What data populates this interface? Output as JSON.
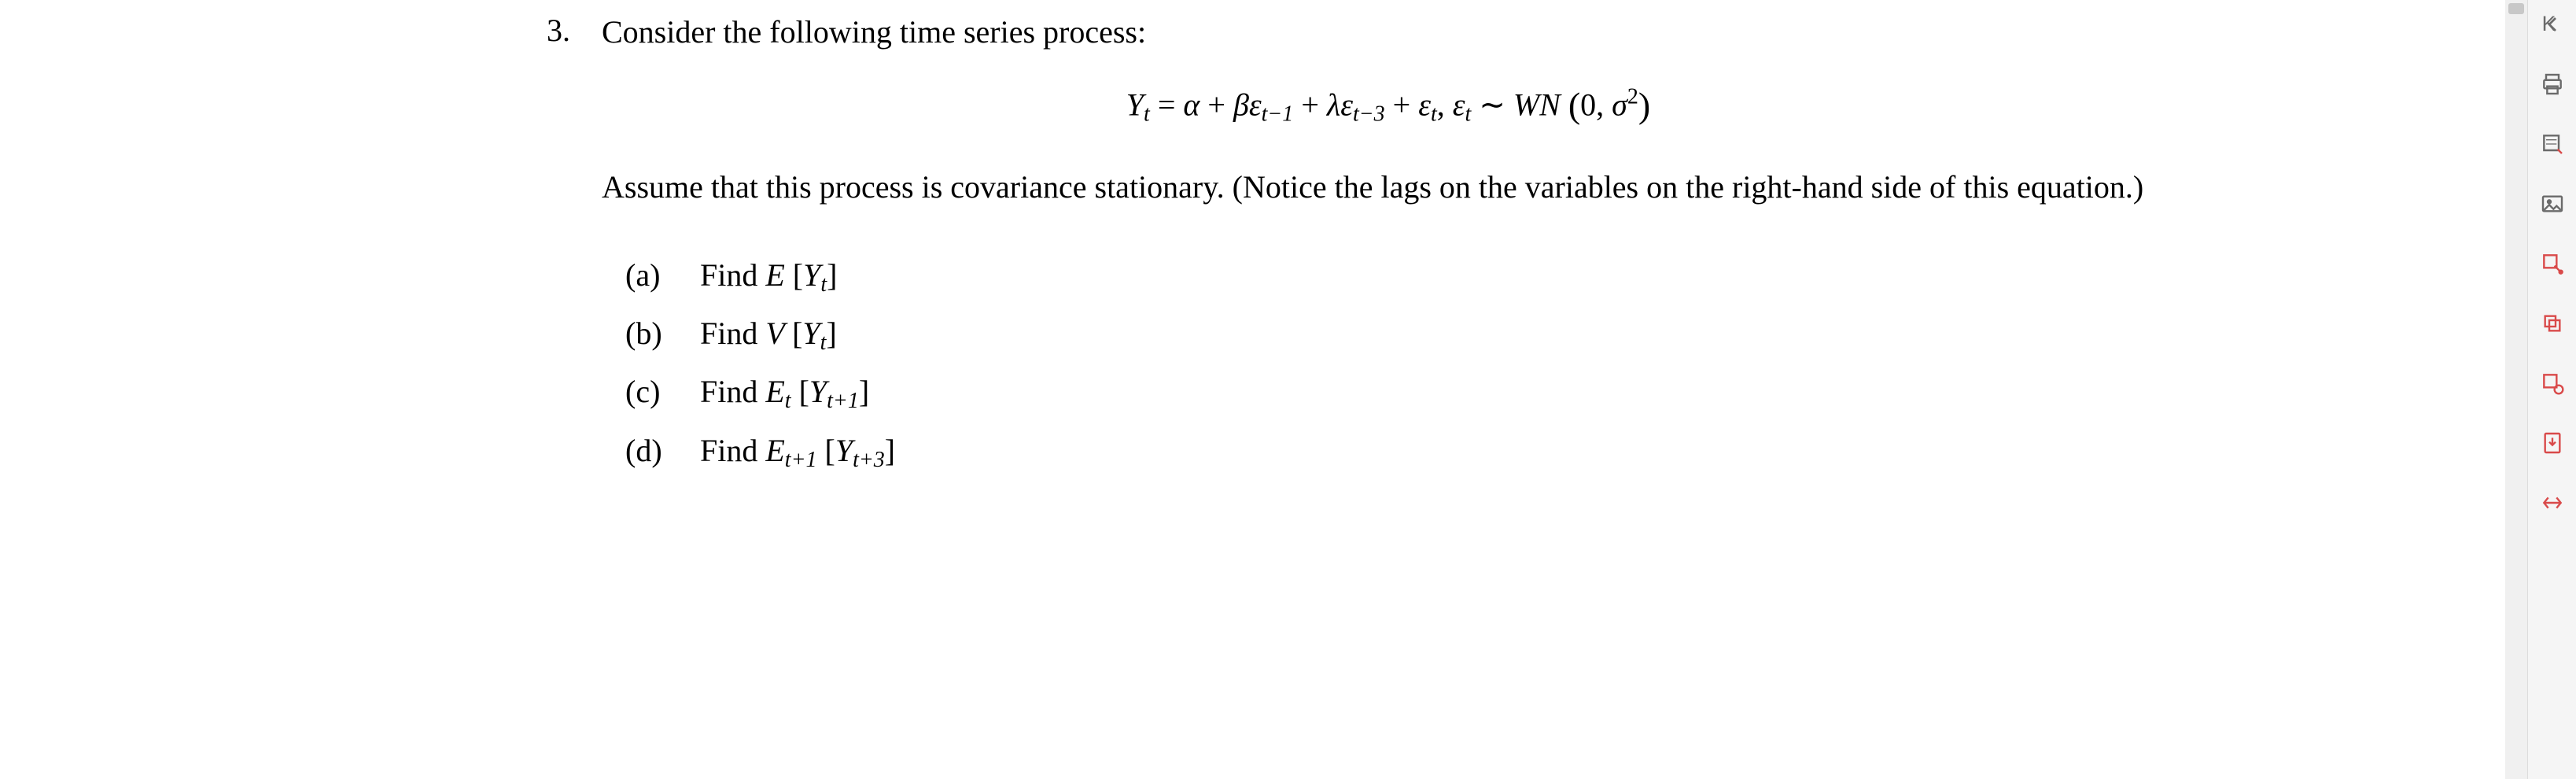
{
  "problem": {
    "number": "3.",
    "intro": "Consider the following time series process:",
    "equation_lhs": "Y",
    "equation_sub_t": "t",
    "equals": " = ",
    "alpha": "α",
    "plus": " + ",
    "beta": "β",
    "eps": "ε",
    "sub_tm1": "t−1",
    "lambda": "λ",
    "sub_tm3": "t−3",
    "comma_space": ",    ",
    "tilde": " ∼ ",
    "wn": "WN",
    "zero": "0, ",
    "sigma": "σ",
    "sq": "2",
    "assumption": "Assume that this process is covariance stationary. (Notice the lags on the variables on the right-hand side of this equation.)",
    "parts": {
      "a": {
        "label": "(a)",
        "verb": "Find ",
        "expr_lead": "E ",
        "bracket_open": "[",
        "inner_var": "Y",
        "inner_sub": "t",
        "bracket_close": "]"
      },
      "b": {
        "label": "(b)",
        "verb": "Find ",
        "expr_lead": "V ",
        "bracket_open": "[",
        "inner_var": "Y",
        "inner_sub": "t",
        "bracket_close": "]"
      },
      "c": {
        "label": "(c)",
        "verb": "Find ",
        "expr_lead": "E",
        "lead_sub": "t",
        "space": " ",
        "bracket_open": "[",
        "inner_var": "Y",
        "inner_sub": "t+1",
        "bracket_close": "]"
      },
      "d": {
        "label": "(d)",
        "verb": "Find ",
        "expr_lead": "E",
        "lead_sub": "t+1",
        "space": " ",
        "bracket_open": "[",
        "inner_var": "Y",
        "inner_sub": "t+3",
        "bracket_close": "]"
      }
    }
  },
  "sidebar": {
    "collapse": "collapse-icon",
    "print": "print-icon",
    "annotate": "annotate-icon",
    "image": "image-icon",
    "tool1": "edit-tool-icon",
    "tool2": "transform-tool-icon",
    "tool3": "object-tool-icon",
    "download": "download-icon",
    "expand": "expand-icon"
  },
  "colors": {
    "accent_red": "#d94a4a",
    "icon_gray": "#6a6a6a",
    "sidebar_bg": "#f5f5f5"
  }
}
